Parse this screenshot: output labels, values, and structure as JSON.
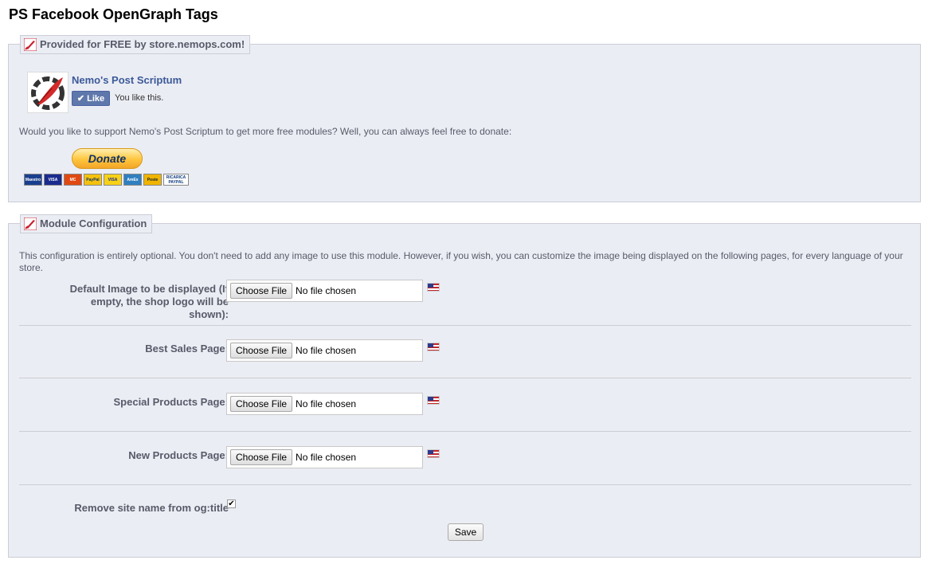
{
  "page": {
    "title": "PS Facebook OpenGraph Tags"
  },
  "promo": {
    "legend": "Provided for FREE by store.nemops.com!",
    "fb_name": "Nemo's Post Scriptum",
    "like_label": "Like",
    "like_text": "You like this.",
    "support_text": "Would you like to support Nemo's Post Scriptum to get more free modules? Well, you can always feel free to donate:",
    "donate_label": "Donate",
    "cards": [
      {
        "name": "Maestro",
        "color": "#1a3f8f"
      },
      {
        "name": "VISA",
        "color": "#1a2b8f"
      },
      {
        "name": "MasterCard",
        "color": "#e04a12"
      },
      {
        "name": "PayPal",
        "color": "#f4c20d"
      },
      {
        "name": "VISA",
        "color": "#f7d117"
      },
      {
        "name": "AmEx",
        "color": "#2f7fc1"
      },
      {
        "name": "Postepay",
        "color": "#f0b400"
      },
      {
        "name": "RICARICA",
        "color": "#ffffff"
      },
      {
        "name": "PAYPAL",
        "color": "#ffffff"
      }
    ]
  },
  "config": {
    "legend": "Module Configuration",
    "intro": "This configuration is entirely optional. You don't need to add any image to use this module. However, if you wish, you can customize the image being displayed on the following pages, for every language of your store.",
    "fields": [
      {
        "label": "Default Image to be displayed (If empty, the shop logo will be shown):",
        "button": "Choose File",
        "status": "No file chosen"
      },
      {
        "label": "Best Sales Page:",
        "button": "Choose File",
        "status": "No file chosen"
      },
      {
        "label": "Special Products Page:",
        "button": "Choose File",
        "status": "No file chosen"
      },
      {
        "label": "New Products Page:",
        "button": "Choose File",
        "status": "No file chosen"
      }
    ],
    "checkbox_label": "Remove site name from og:title",
    "checkbox_checked": true,
    "checkbox_mark": "✔",
    "save_label": "Save"
  },
  "icons": {
    "legend_icon": "red-quill-icon",
    "flag": "us-flag-icon",
    "logo": "quill-gear-logo"
  }
}
